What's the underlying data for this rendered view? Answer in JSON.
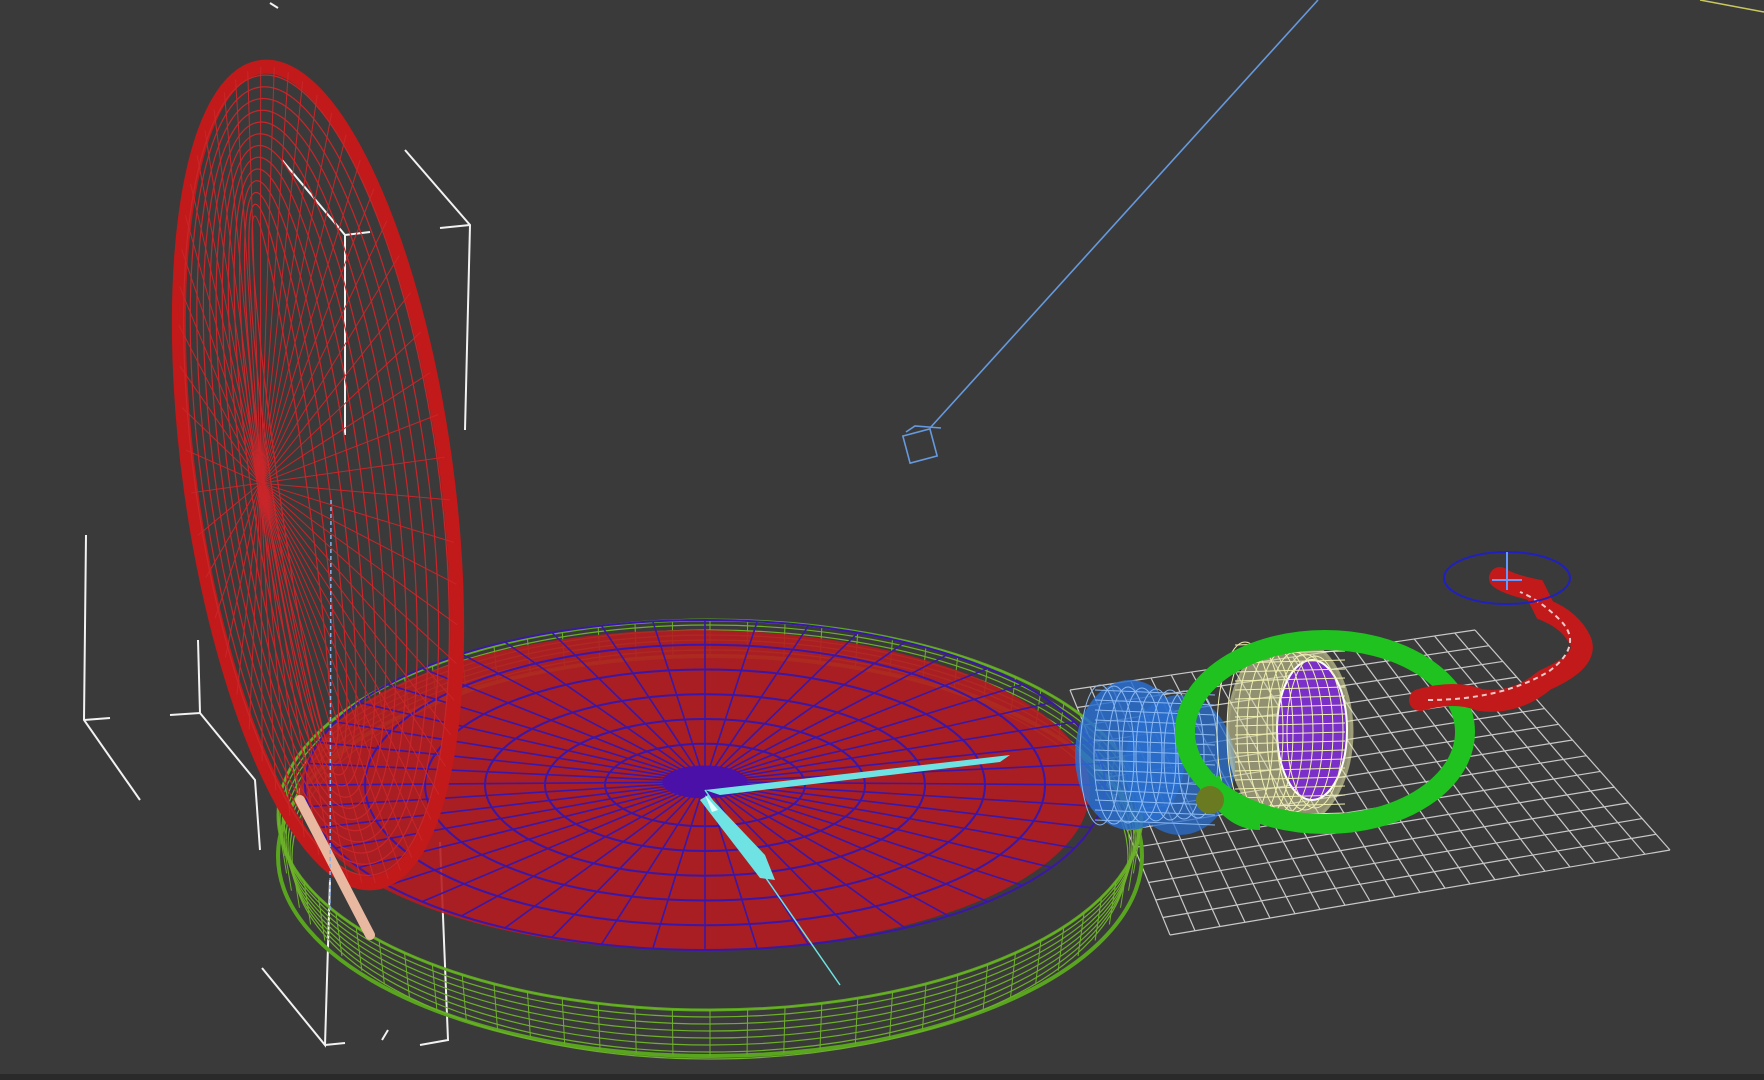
{
  "viewport": {
    "name": "perspective-wireframe-viewport",
    "background": "#3a3a3a",
    "objects": [
      {
        "name": "watch-lid",
        "color": "#c21a1a",
        "mode": "wireframe"
      },
      {
        "name": "watch-case-outer",
        "color": "#5aa51f",
        "mode": "wireframe"
      },
      {
        "name": "watch-face-inner",
        "color": "#3a17a8",
        "mode": "wireframe"
      },
      {
        "name": "watch-dial-red",
        "color": "#c21a1a",
        "mode": "wireframe"
      },
      {
        "name": "watch-hands",
        "color": "#6fe3e3",
        "mode": "wireframe"
      },
      {
        "name": "watch-stem",
        "color": "#2a6fd0",
        "mode": "wireframe"
      },
      {
        "name": "watch-crown",
        "color": "#f0f0b0",
        "mode": "wireframe"
      },
      {
        "name": "watch-bow-ring",
        "color": "#1fc21f",
        "mode": "solid"
      },
      {
        "name": "watch-chain",
        "color": "#c21a1a",
        "mode": "wireframe"
      },
      {
        "name": "ground-grid",
        "color": "#c8c8c8",
        "mode": "wireframe"
      },
      {
        "name": "light-gizmo",
        "color": "#6699dd",
        "mode": "helper"
      },
      {
        "name": "bounding-boxes",
        "color": "#f2f2f2",
        "mode": "helper"
      }
    ]
  }
}
